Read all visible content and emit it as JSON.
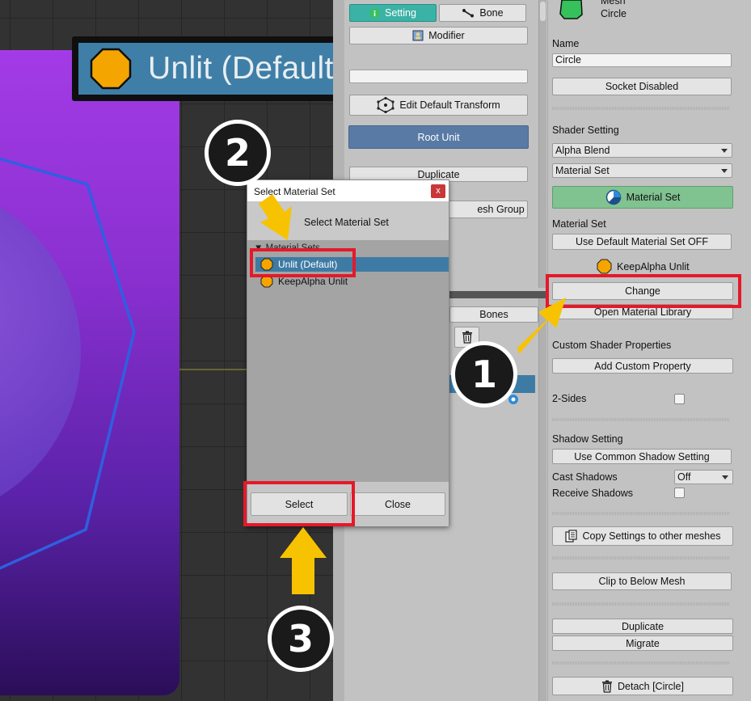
{
  "zoom_label": {
    "text": "Unlit (Default)"
  },
  "mid": {
    "tab_setting": "Setting",
    "tab_bone": "Bone",
    "modifier": "Modifier",
    "edit_default_transform": "Edit Default Transform",
    "root_unit": "Root Unit",
    "duplicate": "Duplicate",
    "mesh_group_partial": "esh Group",
    "bones_tab": "Bones"
  },
  "right": {
    "mesh_type": "Mesh",
    "mesh_name_top": "Circle",
    "name_label": "Name",
    "name_value": "Circle",
    "socket_disabled": "Socket Disabled",
    "shader_setting_label": "Shader Setting",
    "blend_mode": "Alpha Blend",
    "material_mode": "Material Set",
    "material_set_button": "Material Set",
    "material_set_label": "Material Set",
    "use_default_material_set": "Use Default Material Set OFF",
    "current_material": "KeepAlpha Unlit",
    "change": "Change",
    "open_material_library": "Open Material Library",
    "custom_shader_properties": "Custom Shader Properties",
    "add_custom_property": "Add Custom Property",
    "two_sides": "2-Sides",
    "shadow_setting": "Shadow Setting",
    "use_common_shadow": "Use Common Shadow Setting",
    "cast_shadows_label": "Cast Shadows",
    "cast_shadows_value": "Off",
    "receive_shadows_label": "Receive Shadows",
    "copy_settings": "Copy Settings to other meshes",
    "clip_to_below": "Clip to Below Mesh",
    "duplicate": "Duplicate",
    "migrate": "Migrate",
    "detach": "Detach [Circle]"
  },
  "dialog": {
    "title": "Select Material Set",
    "close_x": "x",
    "heading": "Select Material Set",
    "group": "Material Sets",
    "items": [
      "Unlit (Default)",
      "KeepAlpha Unlit"
    ],
    "select": "Select",
    "close": "Close"
  },
  "annotations": {
    "step1": "1",
    "step2": "2",
    "step3": "3"
  },
  "colors": {
    "accent_red": "#e4192a",
    "arrow_yellow": "#f7c300",
    "selection_blue": "#3e7ba4",
    "material_orange": "#f5a500"
  }
}
